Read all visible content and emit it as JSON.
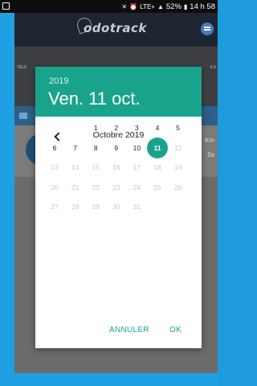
{
  "status_bar": {
    "battery": "52%",
    "time": "14 h 58",
    "network": "LTE+"
  },
  "app": {
    "logo_text": "odotrack",
    "tab_left_label": "TÉLÉ",
    "tab_right_label": "ILS",
    "side_text_1": "Km",
    "side_text_2": "0s"
  },
  "picker": {
    "year": "2019",
    "selected_date": "Ven. 11 oct.",
    "month_label": "Octobre 2019",
    "cancel_label": "ANNULER",
    "ok_label": "OK",
    "accent_color": "#1aa38c",
    "days": [
      {
        "d": "1",
        "state": "enabled"
      },
      {
        "d": "2",
        "state": "enabled"
      },
      {
        "d": "3",
        "state": "enabled"
      },
      {
        "d": "4",
        "state": "enabled"
      },
      {
        "d": "5",
        "state": "enabled"
      },
      {
        "d": "6",
        "state": "enabled"
      },
      {
        "d": "7",
        "state": "enabled"
      },
      {
        "d": "8",
        "state": "enabled"
      },
      {
        "d": "9",
        "state": "enabled"
      },
      {
        "d": "10",
        "state": "enabled"
      },
      {
        "d": "11",
        "state": "selected"
      },
      {
        "d": "12",
        "state": "disabled"
      },
      {
        "d": "13",
        "state": "disabled"
      },
      {
        "d": "14",
        "state": "disabled"
      },
      {
        "d": "15",
        "state": "disabled"
      },
      {
        "d": "16",
        "state": "disabled"
      },
      {
        "d": "17",
        "state": "disabled"
      },
      {
        "d": "18",
        "state": "disabled"
      },
      {
        "d": "19",
        "state": "disabled"
      },
      {
        "d": "20",
        "state": "disabled"
      },
      {
        "d": "21",
        "state": "disabled"
      },
      {
        "d": "22",
        "state": "disabled"
      },
      {
        "d": "23",
        "state": "disabled"
      },
      {
        "d": "24",
        "state": "disabled"
      },
      {
        "d": "25",
        "state": "disabled"
      },
      {
        "d": "26",
        "state": "disabled"
      },
      {
        "d": "27",
        "state": "disabled"
      },
      {
        "d": "28",
        "state": "disabled"
      },
      {
        "d": "29",
        "state": "disabled"
      },
      {
        "d": "30",
        "state": "disabled"
      },
      {
        "d": "31",
        "state": "disabled"
      }
    ]
  }
}
